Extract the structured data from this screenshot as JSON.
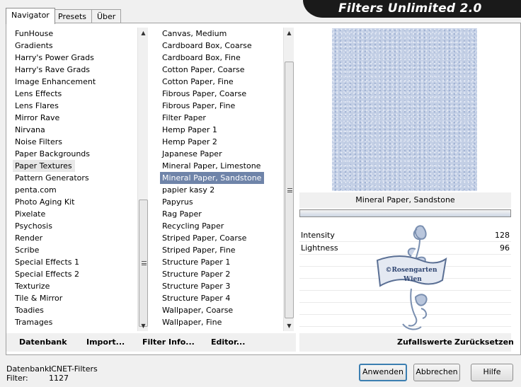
{
  "title": "Filters Unlimited 2.0",
  "tabs": [
    {
      "label": "Navigator"
    },
    {
      "label": "Presets"
    },
    {
      "label": "Über"
    }
  ],
  "categories": [
    "FunHouse",
    "Gradients",
    "Harry's Power Grads",
    "Harry's Rave Grads",
    "Image Enhancement",
    "Lens Effects",
    "Lens Flares",
    "Mirror Rave",
    "Nirvana",
    "Noise Filters",
    "Paper Backgrounds",
    "Paper Textures",
    "Pattern Generators",
    "penta.com",
    "Photo Aging Kit",
    "Pixelate",
    "Psychosis",
    "Render",
    "Scribe",
    "Special Effects 1",
    "Special Effects 2",
    "Texturize",
    "Tile & Mirror",
    "Toadies",
    "Tramages"
  ],
  "selected_category": "Paper Textures",
  "filters": [
    "Canvas, Medium",
    "Cardboard Box, Coarse",
    "Cardboard Box, Fine",
    "Cotton Paper, Coarse",
    "Cotton Paper, Fine",
    "Fibrous Paper, Coarse",
    "Fibrous Paper, Fine",
    "Filter Paper",
    "Hemp Paper 1",
    "Hemp Paper 2",
    "Japanese Paper",
    "Mineral Paper, Limestone",
    "Mineral Paper, Sandstone",
    "papier kasy 2",
    "Papyrus",
    "Rag Paper",
    "Recycling Paper",
    "Striped Paper, Coarse",
    "Striped Paper, Fine",
    "Structure Paper 1",
    "Structure Paper 2",
    "Structure Paper 3",
    "Structure Paper 4",
    "Wallpaper, Coarse",
    "Wallpaper, Fine"
  ],
  "selected_filter": "Mineral Paper, Sandstone",
  "preview_filter_name": "Mineral Paper, Sandstone",
  "params": [
    {
      "label": "Intensity",
      "value": "128"
    },
    {
      "label": "Lightness",
      "value": "96"
    }
  ],
  "watermark": {
    "line1": "©Rosengarten",
    "line2": "Wien"
  },
  "bottom_buttons": {
    "database": "Datenbank",
    "import": "Import...",
    "filter_info": "Filter Info...",
    "editor": "Editor..."
  },
  "right_buttons": {
    "random": "Zufallswerte",
    "reset": "Zurücksetzen"
  },
  "status": {
    "db_label": "Datenbank:",
    "db_value": "ICNET-Filters",
    "filter_label": "Filter:",
    "filter_value": "1127"
  },
  "dialog_buttons": {
    "apply": "Anwenden",
    "cancel": "Abbrechen",
    "help": "Hilfe"
  },
  "colors": {
    "selection": "#6f84a9",
    "preview_texture": "#c3cfe5",
    "title_bg": "#1a1a1a"
  }
}
